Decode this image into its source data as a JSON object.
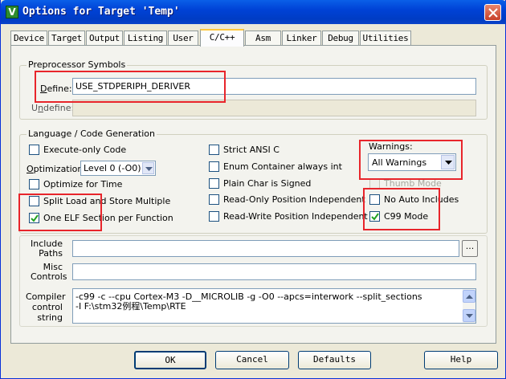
{
  "window": {
    "title": "Options for Target 'Temp'",
    "app_icon": "V"
  },
  "tabs": [
    {
      "label": "Device"
    },
    {
      "label": "Target"
    },
    {
      "label": "Output"
    },
    {
      "label": "Listing"
    },
    {
      "label": "User"
    },
    {
      "label": "C/C++",
      "active": true
    },
    {
      "label": "Asm"
    },
    {
      "label": "Linker"
    },
    {
      "label": "Debug"
    },
    {
      "label": "Utilities"
    }
  ],
  "preprocessor": {
    "title": "Preprocessor Symbols",
    "define_label_ul": "D",
    "define_label_rest": "efine:",
    "define_value": "USE_STDPERIPH_DERIVER",
    "undefine_label_pre": "U",
    "undefine_label_ul": "n",
    "undefine_label_rest": "define:",
    "undefine_value": ""
  },
  "language": {
    "title": "Language / Code Generation",
    "execute_only": {
      "label": "Execute-only Code",
      "checked": false
    },
    "optimization_label_ul": "O",
    "optimization_label_rest": "ptimization:",
    "optimization_value": "Level 0 (-O0)",
    "optimize_time": {
      "label": "Optimize for Time",
      "checked": false
    },
    "split_load": {
      "label": "Split Load and Store Multiple",
      "checked": false
    },
    "one_elf": {
      "label": "One ELF Section per Function",
      "checked": true
    },
    "strict_ansi": {
      "label": "Strict ANSI C",
      "checked": false
    },
    "enum_container": {
      "label": "Enum Container always int",
      "checked": false
    },
    "plain_char": {
      "label": "Plain Char is Signed",
      "checked": false
    },
    "ropi": {
      "label": "Read-Only Position Independent",
      "checked": false
    },
    "rwpi": {
      "label": "Read-Write Position Independent",
      "checked": false
    },
    "warnings_label": "Warnings:",
    "warnings_value": "All Warnings",
    "thumb_mode": {
      "label": "Thumb Mode",
      "checked": false,
      "disabled": true
    },
    "no_auto_includes": {
      "label": "No Auto Includes",
      "checked": false
    },
    "c99_mode": {
      "label": "C99 Mode",
      "checked": true
    }
  },
  "include_paths": {
    "label_line1": "Include",
    "label_line2": "Paths",
    "value": "",
    "browse_label": "..."
  },
  "misc_controls": {
    "label_line1": "Misc",
    "label_line2": "Controls",
    "value": ""
  },
  "compiler_control": {
    "label_line1": "Compiler",
    "label_line2": "control",
    "label_line3": "string",
    "line1": "-c99 -c --cpu Cortex-M3 -D__MICROLIB -g -O0 --apcs=interwork --split_sections",
    "line2": "-I F:\\stm32例程\\Temp\\RTE"
  },
  "buttons": {
    "ok": "OK",
    "cancel": "Cancel",
    "defaults": "Defaults",
    "help": "Help"
  },
  "colors": {
    "titlebar": "#0042d6",
    "highlight_box": "#e8252b",
    "tab_active_accent": "#ffc83c"
  }
}
